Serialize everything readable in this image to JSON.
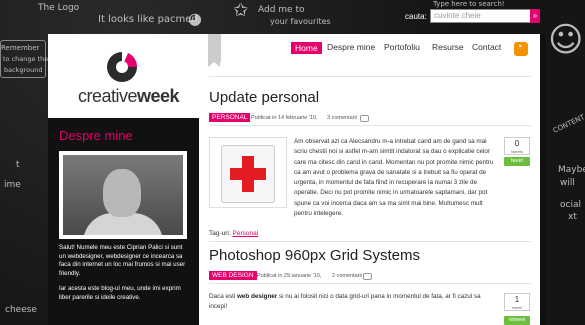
{
  "doodles": {
    "the_logo": "The Logo",
    "looks_like_pacman": "It looks like pacmen",
    "add_me": "Add me to",
    "your_favourites": "your favourites",
    "search_hint": "Type here to search!",
    "remember": "Remember",
    "to_change": "to change the",
    "background": "background",
    "left_t": "t",
    "left_ime": "ime",
    "right_content": "CONTENT",
    "right_maybe": "Maybe",
    "right_will": "will",
    "right_ocial": "ocial",
    "right_xt": "xt",
    "bottom_cheese": "cheese"
  },
  "search": {
    "label": "cauta:",
    "placeholder": "cuvinte cheie",
    "button": "»"
  },
  "logo": {
    "text_light": "creative",
    "text_bold": "week"
  },
  "sidebar": {
    "title": "Despre mine",
    "bio_1": "Salut! Numele meu este Ciprian Palici si sunt un webdesigner, webdesigner ce incearca sa faca din internet un loc mai frumos si mai user friendly.",
    "bio_2": "Iar acesta este blog-ul meu, unde imi exprim liber parerile si ideile creative."
  },
  "nav": {
    "home": "Home",
    "about": "Despre mine",
    "portfolio": "Portofoliu",
    "resources": "Resurse",
    "contact": "Contact"
  },
  "posts": [
    {
      "title": "Update personal",
      "tag": "PERSONAL",
      "meta_published": "Publicat in 14 februarie '10,",
      "comments": "3 comentarii",
      "tweet_count": "0",
      "tweet_word": "tweets",
      "tweet_button": "tweet",
      "body": "Am observat azi ca Alecsandru m-a intrebat cand am de gand sa mai scriu chestii noi si astfel m-am simtit indatorat sa dau o explicatie celor care ma citesc din cand in cand. Momentan nu pot promite nimic pentru ca am avut o problema grava de sanatate si a trebuit sa fiu operat de urgenta, in momentul de fata fiind in recuperare la numai 3 zile de operatie. Deci nu pot promite nimic in urmatoarele saptamani, dar pot spune ca voi incerca daca am sa ma simt mai bine. Multumesc mult pentru intelegere.",
      "tags_label": "Tag-uri:",
      "tags_value": "Personal"
    },
    {
      "title": "Photoshop 960px Grid Systems",
      "tag": "WEB DESIGN",
      "meta_published": "Publicat in 29 ianuarie '10,",
      "comments": "2 comentarii",
      "tweet_count": "1",
      "tweet_word": "tweet",
      "tweet_button": "retweet",
      "body_pre": "Daca esti ",
      "body_bold": "web designer",
      "body_post": " si nu ai folosit nici o data grid-uri pana in momentul de fata, ar fi cazul sa incepi!"
    }
  ],
  "colors": {
    "accent": "#e5006d",
    "chalkboard": "#141414",
    "tweet_green": "#6bbf3c"
  }
}
